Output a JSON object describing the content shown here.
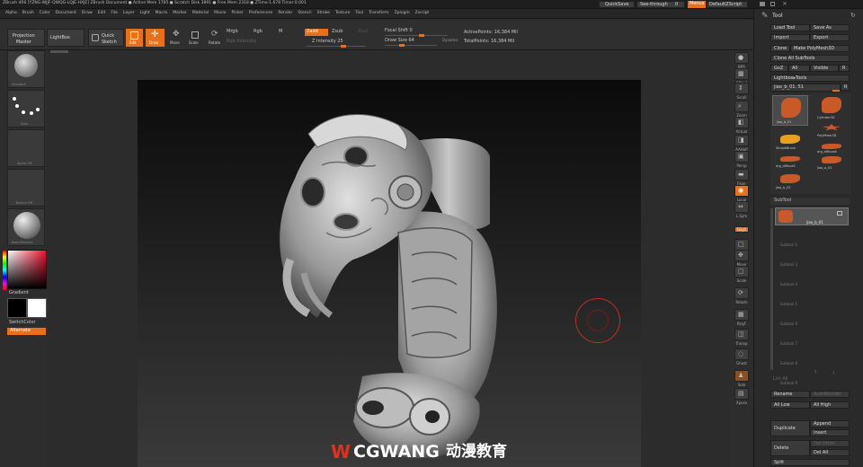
{
  "titlebar": {
    "left": "ZBrush 4R6 [YZNG-WJJF-QWQG-LQJE-HXJE]   ZBrush Document   ● Active Mem 1785 ● Scratch Disk 3891 ● Free Mem 2318 ● ZTime:1.678 Timer:0.001",
    "quicksave": "QuickSave",
    "seethrough": "See-through",
    "seethrough_value": "0",
    "menus": "Menus",
    "defaultzscript": "DefaultZScript"
  },
  "menubar": [
    "Alpha",
    "Brush",
    "Color",
    "Document",
    "Draw",
    "Edit",
    "File",
    "Layer",
    "Light",
    "Macro",
    "Marker",
    "Material",
    "Movie",
    "Picker",
    "Preferences",
    "Render",
    "Stencil",
    "Stroke",
    "Texture",
    "Tool",
    "Transform",
    "Zplugin",
    "Zscript"
  ],
  "toolbar": {
    "projection_master": "Projection\nMaster",
    "lightbox": "LightBox",
    "quick_sketch": "Quick\nSketch",
    "edit": "Edit",
    "draw": "Draw",
    "move": "Move",
    "scale": "Scale",
    "rotate": "Rotate",
    "mrgb": "Mrgb",
    "rgb": "Rgb",
    "m": "M",
    "rgb_intensity": "Rgb Intensity",
    "zadd": "Zadd",
    "zsub": "Zsub",
    "zcut": "Zcut",
    "z_intensity": "Z Intensity 25",
    "focal_shift": "Focal Shift 0",
    "draw_size": "Draw Size 64",
    "dynamic": "Dynamic",
    "active_points": "ActivePoints: 16,384 Mil",
    "total_points": "TotalPoints: 16,384 Mil"
  },
  "leftshelf": {
    "brush": "Standard",
    "stroke": "Dots",
    "alpha": "Alpha Off",
    "texture": "Texture Off",
    "material": "BasicMaterial",
    "gradient": "Gradient",
    "switchcolor": "SwitchColor",
    "alternate": "Alternate"
  },
  "rightshelf": [
    "BPR",
    "SPix 3",
    "Scroll",
    "Zoom",
    "Actual",
    "AAHalf",
    "Persp",
    "Floor",
    "Local",
    "L.Sym",
    "Gxyz",
    "Frame",
    "Move",
    "Scale",
    "Rotate",
    "PolyF",
    "Transp",
    "Ghost",
    "Solo",
    "Xpose"
  ],
  "tool_palette": {
    "title": "Tool",
    "load_tool": "Load Tool",
    "save_as": "Save As",
    "import": "Import",
    "export": "Export",
    "clone": "Clone",
    "make_polymesh": "Make PolyMesh3D",
    "clone_all_subtools": "Clone All SubTools",
    "goz": "GoZ",
    "all": "All",
    "visible": "Visible",
    "r": "R",
    "lightbox_tools": "Lightbox▸Tools",
    "current_tool": "jiao_b_01. 51",
    "current_tool_value": "51",
    "tools": [
      {
        "label": "jiao_b_01",
        "color": "#c85a2a"
      },
      {
        "label": "Cylinder3D",
        "color": "#c85a2a"
      },
      {
        "label": "PolyMesh3D",
        "color": "#d0552a"
      },
      {
        "label": "SimpleBrush",
        "color": "#e8a020"
      },
      {
        "label": "drg_diffuse6",
        "color": "#c85a2a"
      },
      {
        "label": "drg_diffuse5",
        "color": "#c85a2a"
      },
      {
        "label": "jiao_a_03",
        "color": "#c85a2a"
      },
      {
        "label": "jiao_b_03",
        "color": "#c85a2a"
      }
    ],
    "subtool": "SubTool",
    "subtool_item": "jiao_b_01",
    "empty_slots": [
      "Subtool 2",
      "Subtool 3",
      "Subtool 4",
      "Subtool 5",
      "Subtool 6",
      "Subtool 7",
      "Subtool 8",
      "Subtool 9"
    ],
    "list_all": "List All",
    "rename": "Rename",
    "autoreorder": "AutoReorder",
    "all_low": "All Low",
    "all_high": "All High",
    "duplicate": "Duplicate",
    "append": "Append",
    "insert": "Insert",
    "delete": "Delete",
    "del_other": "Del Other",
    "del_all": "Del All",
    "split": "Split"
  },
  "watermark": {
    "logo": "W",
    "brand": "CGWANG",
    "tagline": "动漫教育"
  },
  "colors": {
    "accent": "#e8701a",
    "canvas_top": "#0b0b0b",
    "panel": "#2a2a2a"
  }
}
